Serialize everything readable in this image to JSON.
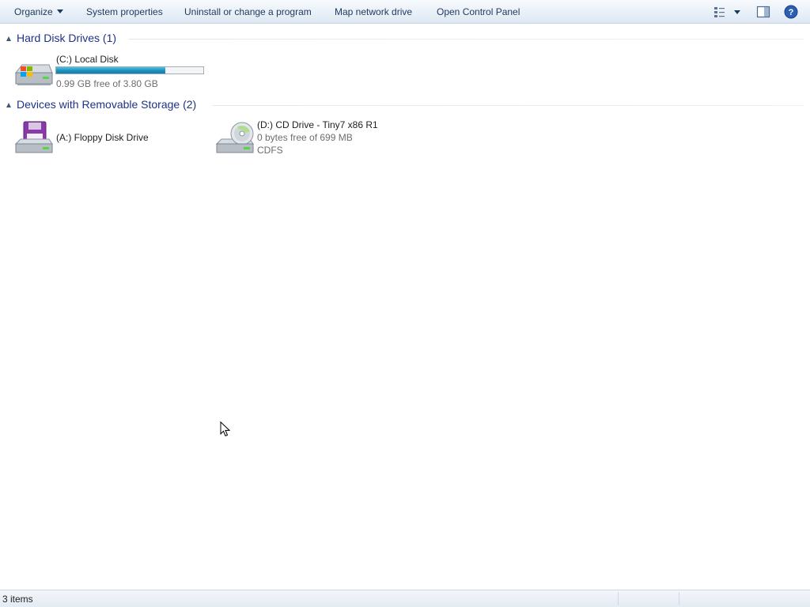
{
  "toolbar": {
    "organize_label": "Organize",
    "system_properties_label": "System properties",
    "uninstall_label": "Uninstall or change a program",
    "map_drive_label": "Map network drive",
    "control_panel_label": "Open Control Panel",
    "icons": {
      "view": "view-options-icon",
      "preview": "preview-pane-icon",
      "help": "help-icon"
    }
  },
  "groups": {
    "hard_disks": {
      "title": "Hard Disk Drives (1)",
      "drives": [
        {
          "name": "(C:) Local Disk",
          "free_text": "0.99 GB free of 3.80 GB",
          "used_fraction": 0.74,
          "icon": "local-disk-icon"
        }
      ]
    },
    "removable": {
      "title": "Devices with Removable Storage (2)",
      "drives": [
        {
          "name": "(A:) Floppy Disk Drive",
          "icon": "floppy-drive-icon"
        },
        {
          "name": "(D:) CD Drive - Tiny7 x86 R1",
          "free_text": "0 bytes free of 699 MB",
          "filesystem": "CDFS",
          "icon": "cd-drive-icon"
        }
      ]
    }
  },
  "status": {
    "items_text": "3 items"
  },
  "colors": {
    "capacity_bar": "#1f93bf",
    "group_title": "#1e3287",
    "toolbar_text": "#1e395b",
    "help_blue": "#2c5fb3"
  }
}
